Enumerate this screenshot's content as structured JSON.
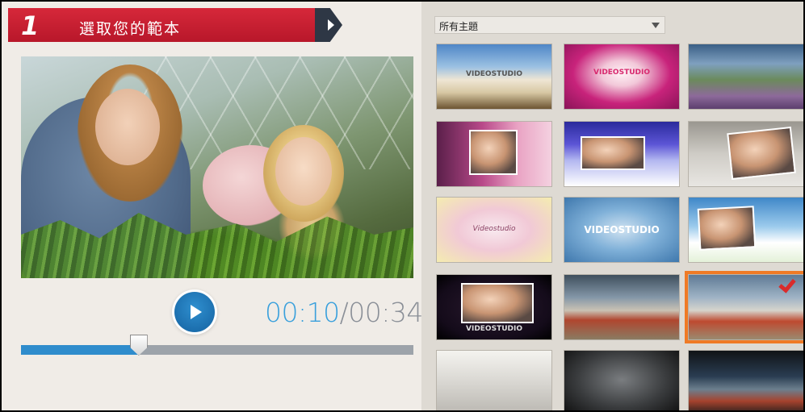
{
  "step": {
    "number": "1",
    "title": "選取您的範本"
  },
  "player": {
    "current_time": "00:10",
    "separator": "/",
    "total_time": "00:34",
    "progress": 0.3
  },
  "theme_filter": {
    "selected": "所有主題"
  },
  "templates": [
    {
      "label": "VIDEOSTUDIO"
    },
    {
      "label": "VIDEOSTUDIO"
    },
    {
      "label": ""
    },
    {
      "label": ""
    },
    {
      "label": ""
    },
    {
      "label": ""
    },
    {
      "label": "Videostudio"
    },
    {
      "label": "VIDEOSTUDIO"
    },
    {
      "label": ""
    },
    {
      "label": "VIDEOSTUDIO"
    },
    {
      "label": ""
    },
    {
      "label": ""
    },
    {
      "label": ""
    },
    {
      "label": ""
    },
    {
      "label": ""
    }
  ],
  "selected_template_index": 11,
  "colors": {
    "accent_red": "#c81f31",
    "accent_blue": "#2f8ccc",
    "selection_orange": "#ef7a25"
  }
}
